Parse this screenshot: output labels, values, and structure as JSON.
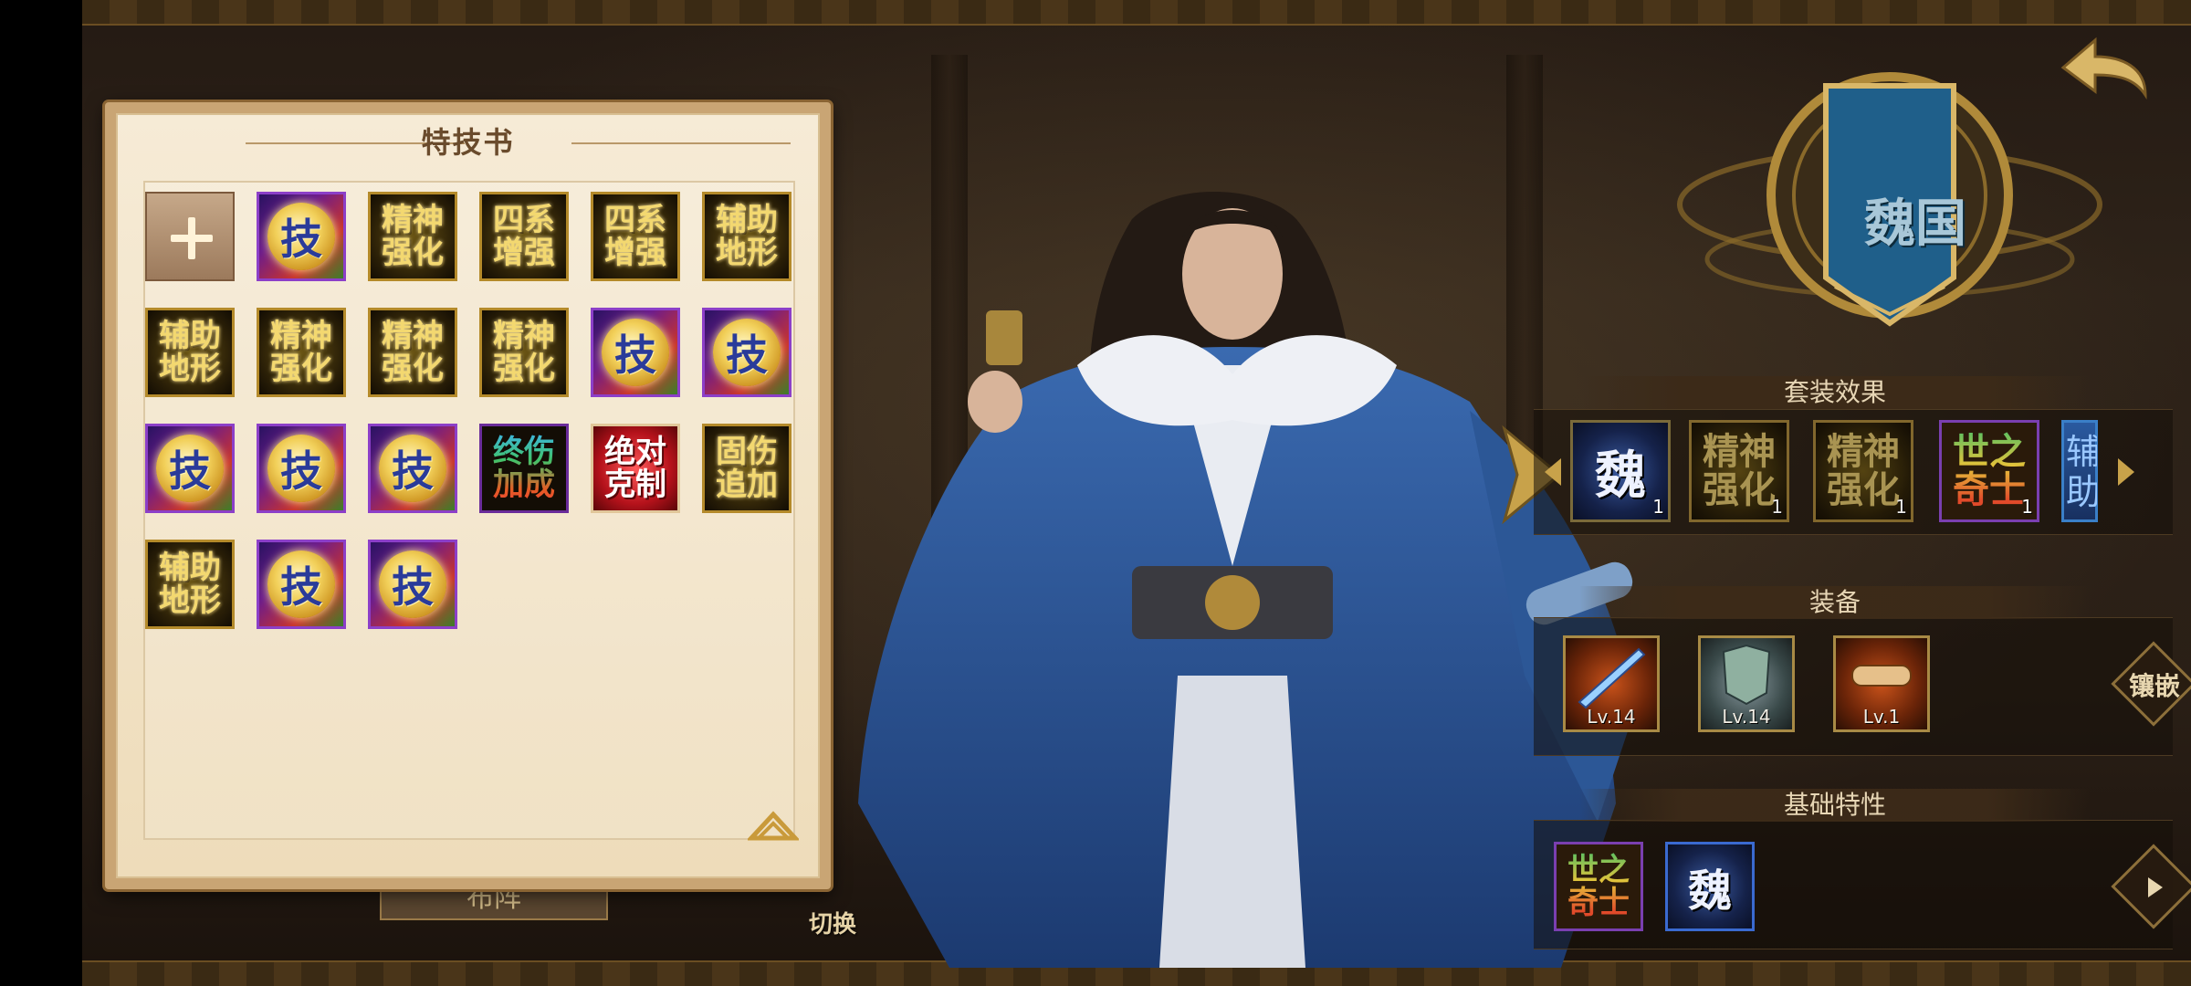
{
  "panel": {
    "title": "特技书",
    "slots": [
      {
        "kind": "add"
      },
      {
        "kind": "skill",
        "text": "技"
      },
      {
        "kind": "gold",
        "text": "精神\n强化"
      },
      {
        "kind": "gold",
        "text": "四系\n增强"
      },
      {
        "kind": "gold",
        "text": "四系\n增强"
      },
      {
        "kind": "gold",
        "text": "辅助\n地形"
      },
      {
        "kind": "gold",
        "text": "辅助\n地形"
      },
      {
        "kind": "gold",
        "text": "精神\n强化"
      },
      {
        "kind": "gold",
        "text": "精神\n强化"
      },
      {
        "kind": "gold",
        "text": "精神\n强化"
      },
      {
        "kind": "skill",
        "text": "技"
      },
      {
        "kind": "skill",
        "text": "技"
      },
      {
        "kind": "skill",
        "text": "技"
      },
      {
        "kind": "skill",
        "text": "技"
      },
      {
        "kind": "skill",
        "text": "技"
      },
      {
        "kind": "multi",
        "text": "终伤\n加成"
      },
      {
        "kind": "red",
        "text": "绝对\n克制"
      },
      {
        "kind": "gold",
        "text": "固伤\n追加"
      },
      {
        "kind": "gold",
        "text": "辅助\n地形"
      },
      {
        "kind": "skill",
        "text": "技"
      },
      {
        "kind": "skill",
        "text": "技"
      }
    ]
  },
  "behind": {
    "button_text": "布阵",
    "switch_label": "切换"
  },
  "faction": {
    "banner_text": "魏国"
  },
  "set_effect": {
    "header": "套装效果",
    "items": [
      {
        "kind": "wei",
        "text": "魏",
        "count": "1"
      },
      {
        "kind": "gold",
        "text": "精神\n强化",
        "count": "1"
      },
      {
        "kind": "gold",
        "text": "精神\n强化",
        "count": "1"
      },
      {
        "kind": "rainbow",
        "text": "世之\n奇士",
        "count": "1"
      },
      {
        "kind": "partial",
        "text": "辅\n助"
      }
    ]
  },
  "equipment": {
    "header": "装备",
    "items": [
      {
        "name": "weapon",
        "level": "Lv.14"
      },
      {
        "name": "armor",
        "level": "Lv.14"
      },
      {
        "name": "scroll",
        "level": "Lv.1"
      }
    ],
    "inlay_label": "镶嵌"
  },
  "traits": {
    "header": "基础特性",
    "items": [
      {
        "kind": "rainbow",
        "text": "世之\n奇士"
      },
      {
        "kind": "wei",
        "text": "魏"
      }
    ]
  },
  "colors": {
    "banner_blue": "#1f5f8a",
    "gold": "#f3d870",
    "panel_bg": "#f3e6cc"
  }
}
